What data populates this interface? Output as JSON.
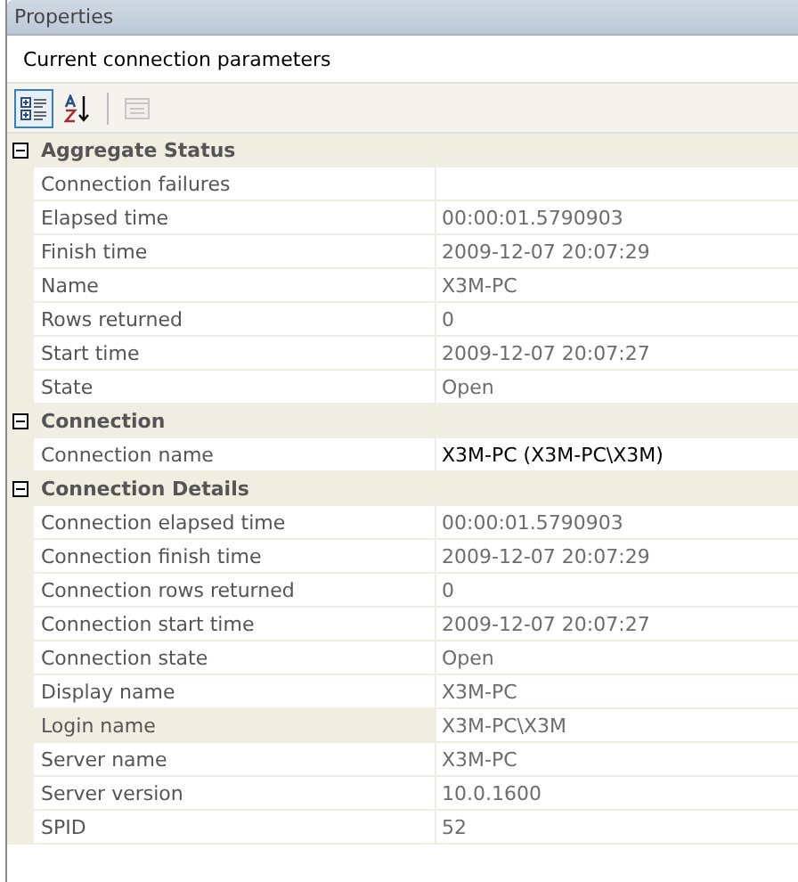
{
  "window": {
    "title": "Properties"
  },
  "object_name": "Current connection parameters",
  "toolbar": [
    {
      "kind": "categorized",
      "selected": true,
      "disabled": false
    },
    {
      "kind": "alphabetical",
      "selected": false,
      "disabled": false
    },
    {
      "kind": "property-pages",
      "selected": false,
      "disabled": true
    }
  ],
  "categories": [
    {
      "name": "Aggregate Status",
      "expanded": true,
      "properties": [
        {
          "name": "Connection failures",
          "readonly": true,
          "selected": false
        },
        {
          "name": "Elapsed time",
          "value": "00:00:01.5790903",
          "readonly": true,
          "selected": false
        },
        {
          "name": "Finish time",
          "value": "2009-12-07 20:07:29",
          "readonly": true,
          "selected": false
        },
        {
          "name": "Name",
          "value": "X3M-PC",
          "readonly": true,
          "selected": false
        },
        {
          "name": "Rows returned",
          "value": "0",
          "readonly": true,
          "selected": false
        },
        {
          "name": "Start time",
          "value": "2009-12-07 20:07:27",
          "readonly": true,
          "selected": false
        },
        {
          "name": "State",
          "value": "Open",
          "readonly": true,
          "selected": false
        }
      ]
    },
    {
      "name": "Connection",
      "expanded": true,
      "properties": [
        {
          "name": "Connection name",
          "value": "X3M-PC (X3M-PC\\X3M)",
          "readonly": false,
          "selected": false
        }
      ]
    },
    {
      "name": "Connection Details",
      "expanded": true,
      "properties": [
        {
          "name": "Connection elapsed time",
          "value": "00:00:01.5790903",
          "readonly": true,
          "selected": false
        },
        {
          "name": "Connection finish time",
          "value": "2009-12-07 20:07:29",
          "readonly": true,
          "selected": false
        },
        {
          "name": "Connection rows returned",
          "value": "0",
          "readonly": true,
          "selected": false
        },
        {
          "name": "Connection start time",
          "value": "2009-12-07 20:07:27",
          "readonly": true,
          "selected": false
        },
        {
          "name": "Connection state",
          "value": "Open",
          "readonly": true,
          "selected": false
        },
        {
          "name": "Display name",
          "value": "X3M-PC",
          "readonly": true,
          "selected": false
        },
        {
          "name": "Login name",
          "value": "X3M-PC\\X3M",
          "readonly": true,
          "selected": true
        },
        {
          "name": "Server name",
          "value": "X3M-PC",
          "readonly": true,
          "selected": false
        },
        {
          "name": "Server version",
          "value": "10.0.1600",
          "readonly": true,
          "selected": false
        },
        {
          "name": "SPID",
          "value": "52",
          "readonly": true,
          "selected": false
        }
      ]
    }
  ]
}
